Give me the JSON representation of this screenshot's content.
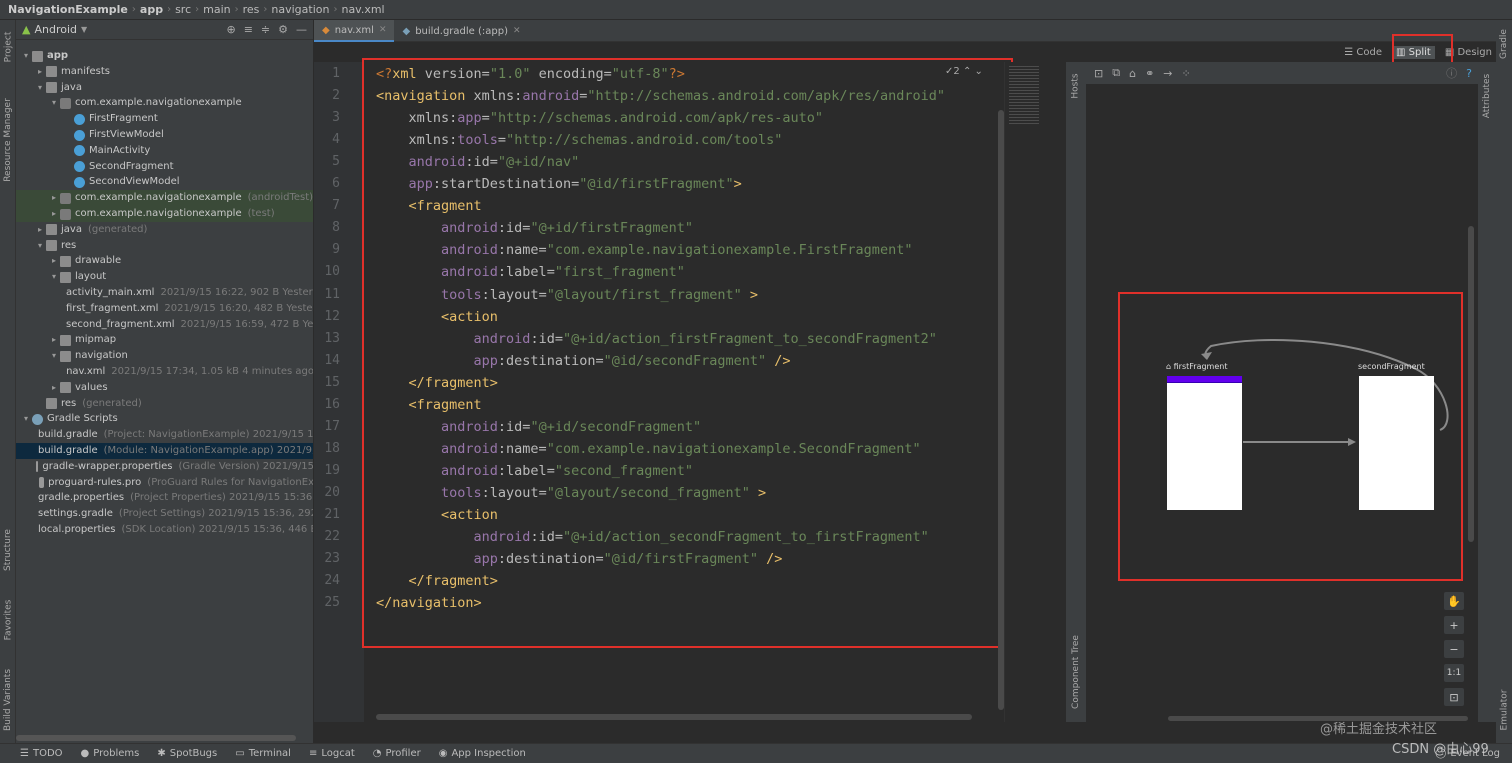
{
  "breadcrumb": [
    "NavigationExample",
    "app",
    "src",
    "main",
    "res",
    "navigation",
    "nav.xml"
  ],
  "left_tabs": {
    "project": "Project",
    "resource_manager": "Resource Manager",
    "structure": "Structure",
    "favorites": "Favorites",
    "build_variants": "Build Variants"
  },
  "project_panel": {
    "view_selector": "Android"
  },
  "tree": [
    {
      "label": "app",
      "meta": "",
      "depth": 0,
      "icon": "folder",
      "arrow": "▾",
      "bold": true
    },
    {
      "label": "manifests",
      "meta": "",
      "depth": 1,
      "icon": "folder",
      "arrow": "▸"
    },
    {
      "label": "java",
      "meta": "",
      "depth": 1,
      "icon": "folder",
      "arrow": "▾"
    },
    {
      "label": "com.example.navigationexample",
      "meta": "",
      "depth": 2,
      "icon": "pkg",
      "arrow": "▾"
    },
    {
      "label": "FirstFragment",
      "meta": "",
      "depth": 3,
      "icon": "kt",
      "arrow": ""
    },
    {
      "label": "FirstViewModel",
      "meta": "",
      "depth": 3,
      "icon": "kt",
      "arrow": ""
    },
    {
      "label": "MainActivity",
      "meta": "",
      "depth": 3,
      "icon": "kt",
      "arrow": ""
    },
    {
      "label": "SecondFragment",
      "meta": "",
      "depth": 3,
      "icon": "kt",
      "arrow": ""
    },
    {
      "label": "SecondViewModel",
      "meta": "",
      "depth": 3,
      "icon": "kt",
      "arrow": ""
    },
    {
      "label": "com.example.navigationexample",
      "meta": "(androidTest)",
      "depth": 2,
      "icon": "pkg",
      "arrow": "▸",
      "hl": true
    },
    {
      "label": "com.example.navigationexample",
      "meta": "(test)",
      "depth": 2,
      "icon": "pkg",
      "arrow": "▸",
      "hl": true
    },
    {
      "label": "java",
      "meta": "(generated)",
      "depth": 1,
      "icon": "folder",
      "arrow": "▸"
    },
    {
      "label": "res",
      "meta": "",
      "depth": 1,
      "icon": "folder",
      "arrow": "▾"
    },
    {
      "label": "drawable",
      "meta": "",
      "depth": 2,
      "icon": "folder",
      "arrow": "▸"
    },
    {
      "label": "layout",
      "meta": "",
      "depth": 2,
      "icon": "folder",
      "arrow": "▾"
    },
    {
      "label": "activity_main.xml",
      "meta": "2021/9/15 16:22, 902 B Yesterday",
      "depth": 3,
      "icon": "xml",
      "arrow": ""
    },
    {
      "label": "first_fragment.xml",
      "meta": "2021/9/15 16:20, 482 B Yesterday",
      "depth": 3,
      "icon": "xml",
      "arrow": ""
    },
    {
      "label": "second_fragment.xml",
      "meta": "2021/9/15 16:59, 472 B Yeste",
      "depth": 3,
      "icon": "xml",
      "arrow": ""
    },
    {
      "label": "mipmap",
      "meta": "",
      "depth": 2,
      "icon": "folder",
      "arrow": "▸"
    },
    {
      "label": "navigation",
      "meta": "",
      "depth": 2,
      "icon": "folder",
      "arrow": "▾"
    },
    {
      "label": "nav.xml",
      "meta": "2021/9/15 17:34, 1.05 kB 4 minutes ago",
      "depth": 3,
      "icon": "xml",
      "arrow": ""
    },
    {
      "label": "values",
      "meta": "",
      "depth": 2,
      "icon": "folder",
      "arrow": "▸"
    },
    {
      "label": "res",
      "meta": "(generated)",
      "depth": 1,
      "icon": "folder",
      "arrow": ""
    },
    {
      "label": "Gradle Scripts",
      "meta": "",
      "depth": 0,
      "icon": "gradle",
      "arrow": "▾"
    },
    {
      "label": "build.gradle",
      "meta": "(Project: NavigationExample)  2021/9/15 17",
      "depth": 1,
      "icon": "gradle",
      "arrow": ""
    },
    {
      "label": "build.gradle",
      "meta": "(Module: NavigationExample.app)  2021/9,",
      "depth": 1,
      "icon": "gradle",
      "arrow": "",
      "sel": true
    },
    {
      "label": "gradle-wrapper.properties",
      "meta": "(Gradle Version)  2021/9/15",
      "depth": 1,
      "icon": "props",
      "arrow": ""
    },
    {
      "label": "proguard-rules.pro",
      "meta": "(ProGuard Rules for NavigationEx",
      "depth": 1,
      "icon": "props",
      "arrow": ""
    },
    {
      "label": "gradle.properties",
      "meta": "(Project Properties)  2021/9/15 15:36,",
      "depth": 1,
      "icon": "props",
      "arrow": ""
    },
    {
      "label": "settings.gradle",
      "meta": "(Project Settings)  2021/9/15 15:36, 292 B",
      "depth": 1,
      "icon": "gradle",
      "arrow": ""
    },
    {
      "label": "local.properties",
      "meta": "(SDK Location)  2021/9/15 15:36, 446 B",
      "depth": 1,
      "icon": "props",
      "arrow": ""
    }
  ],
  "tabs": [
    {
      "label": "nav.xml",
      "active": true
    },
    {
      "label": "build.gradle (:app)",
      "active": false
    }
  ],
  "modes": {
    "code": "Code",
    "split": "Split",
    "design": "Design"
  },
  "inspection": "✓2",
  "code_lines": [
    [
      [
        "p",
        "<?"
      ],
      [
        "t",
        "xml "
      ],
      [
        "a",
        "version="
      ],
      [
        "v",
        "\"1.0\" "
      ],
      [
        "a",
        "encoding="
      ],
      [
        "v",
        "\"utf-8\""
      ],
      [
        "p",
        "?>"
      ]
    ],
    [
      [
        "t",
        "<navigation "
      ],
      [
        "a",
        "xmlns:"
      ],
      [
        "ns",
        "android"
      ],
      [
        "a",
        "="
      ],
      [
        "v",
        "\"http://schemas.android.com/apk/res/android\""
      ]
    ],
    [
      [
        "a",
        "    xmlns:"
      ],
      [
        "ns",
        "app"
      ],
      [
        "a",
        "="
      ],
      [
        "v",
        "\"http://schemas.android.com/apk/res-auto\""
      ]
    ],
    [
      [
        "a",
        "    xmlns:"
      ],
      [
        "ns",
        "tools"
      ],
      [
        "a",
        "="
      ],
      [
        "v",
        "\"http://schemas.android.com/tools\""
      ]
    ],
    [
      [
        "ns",
        "    android"
      ],
      [
        "a",
        ":id="
      ],
      [
        "v",
        "\"@+id/nav\""
      ]
    ],
    [
      [
        "ns",
        "    app"
      ],
      [
        "a",
        ":startDestination="
      ],
      [
        "v",
        "\"@id/firstFragment\""
      ],
      [
        "t",
        ">"
      ]
    ],
    [
      [
        "t",
        "    <fragment"
      ]
    ],
    [
      [
        "ns",
        "        android"
      ],
      [
        "a",
        ":id="
      ],
      [
        "v",
        "\"@+id/firstFragment\""
      ]
    ],
    [
      [
        "ns",
        "        android"
      ],
      [
        "a",
        ":name="
      ],
      [
        "v",
        "\"com.example.navigationexample.FirstFragment\""
      ]
    ],
    [
      [
        "ns",
        "        android"
      ],
      [
        "a",
        ":label="
      ],
      [
        "v",
        "\"first_fragment\""
      ]
    ],
    [
      [
        "ns",
        "        tools"
      ],
      [
        "a",
        ":layout="
      ],
      [
        "v",
        "\"@layout/first_fragment\" "
      ],
      [
        "t",
        ">"
      ]
    ],
    [
      [
        "t",
        "        <action"
      ]
    ],
    [
      [
        "ns",
        "            android"
      ],
      [
        "a",
        ":id="
      ],
      [
        "v",
        "\"@+id/action_firstFragment_to_secondFragment2\""
      ]
    ],
    [
      [
        "ns",
        "            app"
      ],
      [
        "a",
        ":destination="
      ],
      [
        "v",
        "\"@id/secondFragment\" "
      ],
      [
        "t",
        "/>"
      ]
    ],
    [
      [
        "t",
        "    </fragment>"
      ]
    ],
    [
      [
        "t",
        "    <fragment"
      ]
    ],
    [
      [
        "ns",
        "        android"
      ],
      [
        "a",
        ":id="
      ],
      [
        "v",
        "\"@+id/secondFragment\""
      ]
    ],
    [
      [
        "ns",
        "        android"
      ],
      [
        "a",
        ":name="
      ],
      [
        "v",
        "\"com.example.navigationexample.SecondFragment\""
      ]
    ],
    [
      [
        "ns",
        "        android"
      ],
      [
        "a",
        ":label="
      ],
      [
        "v",
        "\"second_fragment\""
      ]
    ],
    [
      [
        "ns",
        "        tools"
      ],
      [
        "a",
        ":layout="
      ],
      [
        "v",
        "\"@layout/second_fragment\" "
      ],
      [
        "t",
        ">"
      ]
    ],
    [
      [
        "t",
        "        <action"
      ]
    ],
    [
      [
        "ns",
        "            android"
      ],
      [
        "a",
        ":id="
      ],
      [
        "v",
        "\"@+id/action_secondFragment_to_firstFragment\""
      ]
    ],
    [
      [
        "ns",
        "            app"
      ],
      [
        "a",
        ":destination="
      ],
      [
        "v",
        "\"@id/firstFragment\" "
      ],
      [
        "t",
        "/>"
      ]
    ],
    [
      [
        "t",
        "    </fragment>"
      ]
    ],
    [
      [
        "t",
        "</navigation>"
      ]
    ]
  ],
  "design": {
    "hosts_tab": "Hosts",
    "component_tree_tab": "Component Tree",
    "first_label": "firstFragment",
    "second_label": "secondFragment",
    "zoom_fit": "1:1"
  },
  "right_tabs": {
    "gradle": "Gradle",
    "attributes": "Attributes",
    "emulator": "Emulator"
  },
  "status": {
    "todo": "TODO",
    "problems": "Problems",
    "spotbugs": "SpotBugs",
    "terminal": "Terminal",
    "logcat": "Logcat",
    "profiler": "Profiler",
    "app_inspection": "App Inspection",
    "event_log": "Event Log"
  },
  "watermark": {
    "site": "@稀土掘金技术社区",
    "author": "CSDN @由心99"
  },
  "colors": {
    "red_box": "#e0302a",
    "accent": "#4a88c7"
  }
}
